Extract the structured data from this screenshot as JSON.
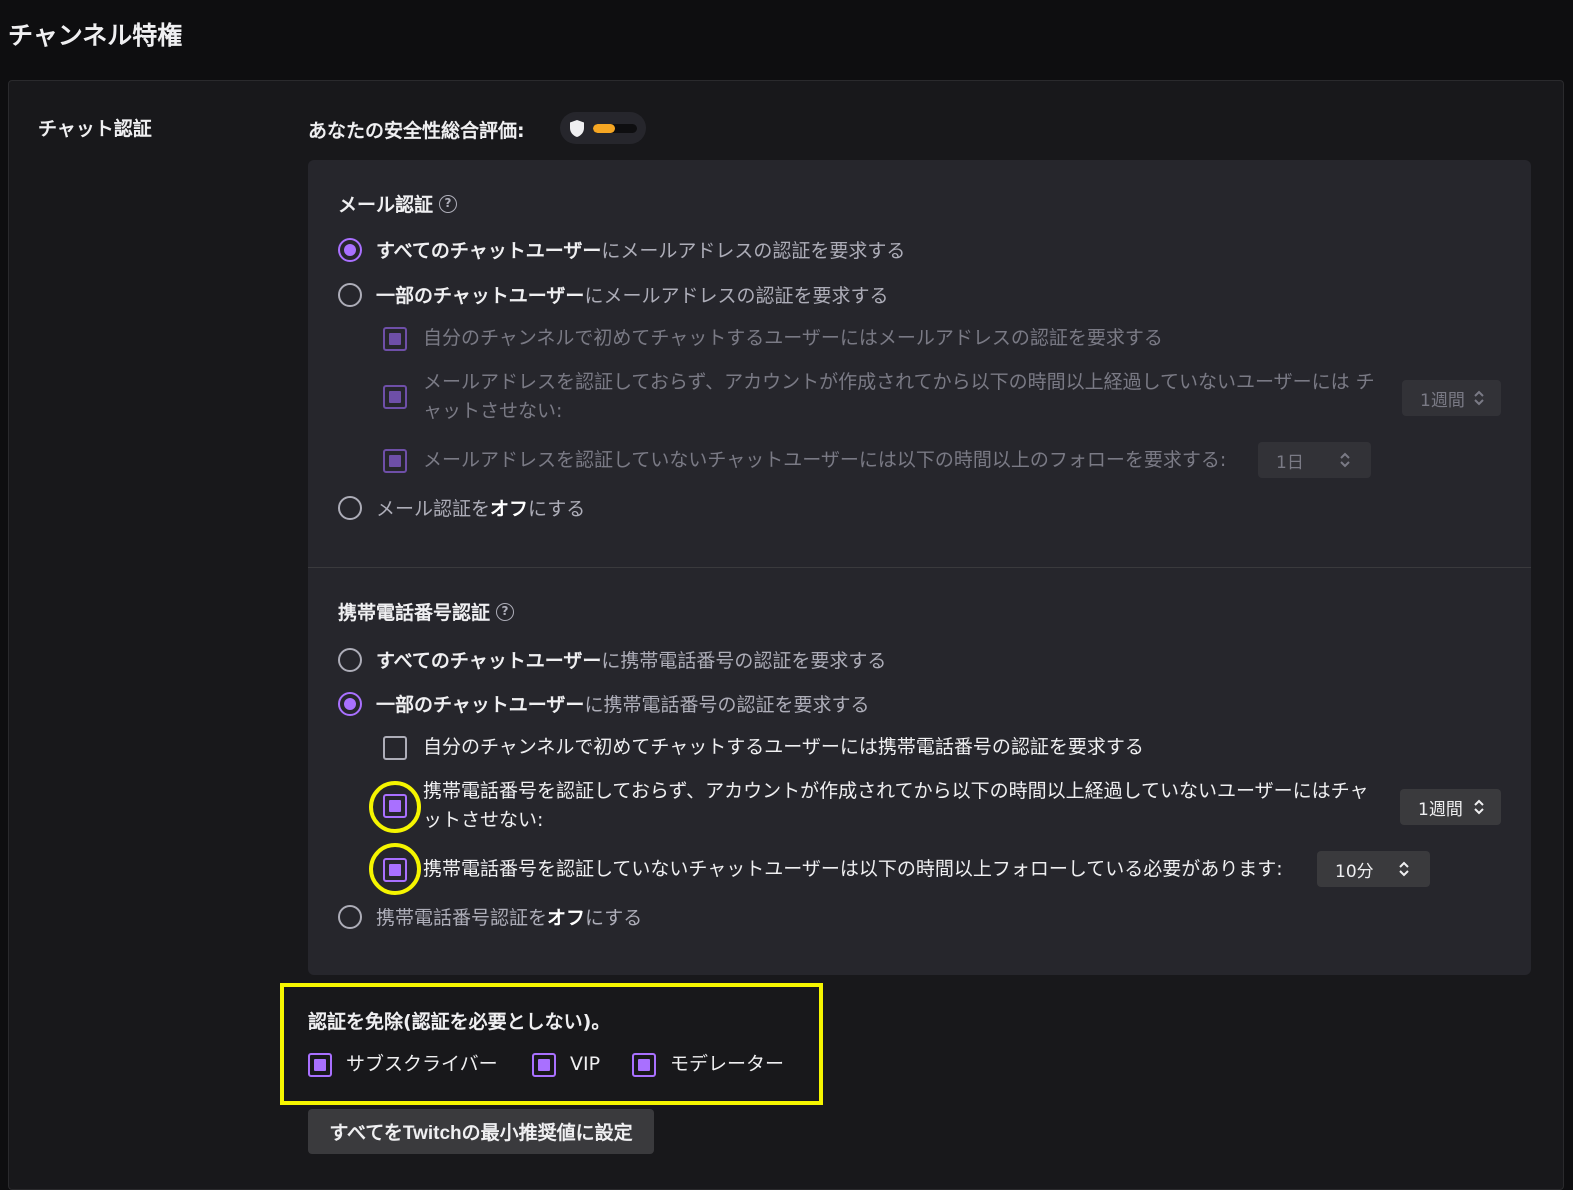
{
  "page": {
    "title": "チャンネル特権"
  },
  "section": {
    "label": "チャット認証"
  },
  "safety": {
    "label": "あなたの安全性総合評価:",
    "level": 0.5,
    "color": "#f5a623"
  },
  "email": {
    "heading": "メール認証",
    "help": "?",
    "options": [
      {
        "bold": "すべてのチャットユーザー",
        "rest": "にメールアドレスの認証を要求する",
        "selected": true
      },
      {
        "bold": "一部のチャットユーザー",
        "rest": "にメールアドレスの認証を要求する",
        "selected": false
      }
    ],
    "sub": [
      {
        "text": "自分のチャンネルで初めてチャットするユーザーにはメールアドレスの認証を要求する",
        "checked": true
      },
      {
        "text": "メールアドレスを認証しておらず、アカウントが作成されてから以下の時間以上経過していないユーザーには チャットさせない:",
        "checked": true,
        "select": "1週間"
      },
      {
        "text": "メールアドレスを認証していないチャットユーザーには以下の時間以上のフォローを要求する:",
        "checked": true,
        "select": "1日"
      }
    ],
    "off": {
      "pre": "メール認証を",
      "bold": "オフ",
      "post": "にする",
      "selected": false
    }
  },
  "phone": {
    "heading": "携帯電話番号認証",
    "help": "?",
    "options": [
      {
        "bold": "すべてのチャットユーザー",
        "rest": "に携帯電話番号の認証を要求する",
        "selected": false
      },
      {
        "bold": "一部のチャットユーザー",
        "rest": "に携帯電話番号の認証を要求する",
        "selected": true
      }
    ],
    "sub": [
      {
        "text": "自分のチャンネルで初めてチャットするユーザーには携帯電話番号の認証を要求する",
        "checked": false
      },
      {
        "text": "携帯電話番号を認証しておらず、アカウントが作成されてから以下の時間以上経過していないユーザーにはチャットさせない:",
        "checked": true,
        "select": "1週間"
      },
      {
        "text": "携帯電話番号を認証していないチャットユーザーは以下の時間以上フォローしている必要があります:",
        "checked": true,
        "select": "10分"
      }
    ],
    "off": {
      "pre": "携帯電話番号認証を",
      "bold": "オフ",
      "post": "にする",
      "selected": false
    }
  },
  "exempt": {
    "title": "認証を免除(認証を必要としない)。",
    "items": [
      {
        "label": "サブスクライバー",
        "checked": true
      },
      {
        "label": "VIP",
        "checked": true
      },
      {
        "label": "モデレーター",
        "checked": true
      }
    ]
  },
  "reset_button": "すべてをTwitchの最小推奨値に設定",
  "colors": {
    "accent": "#a970ff",
    "highlight": "#f5f500",
    "background": "#0e0e10"
  }
}
